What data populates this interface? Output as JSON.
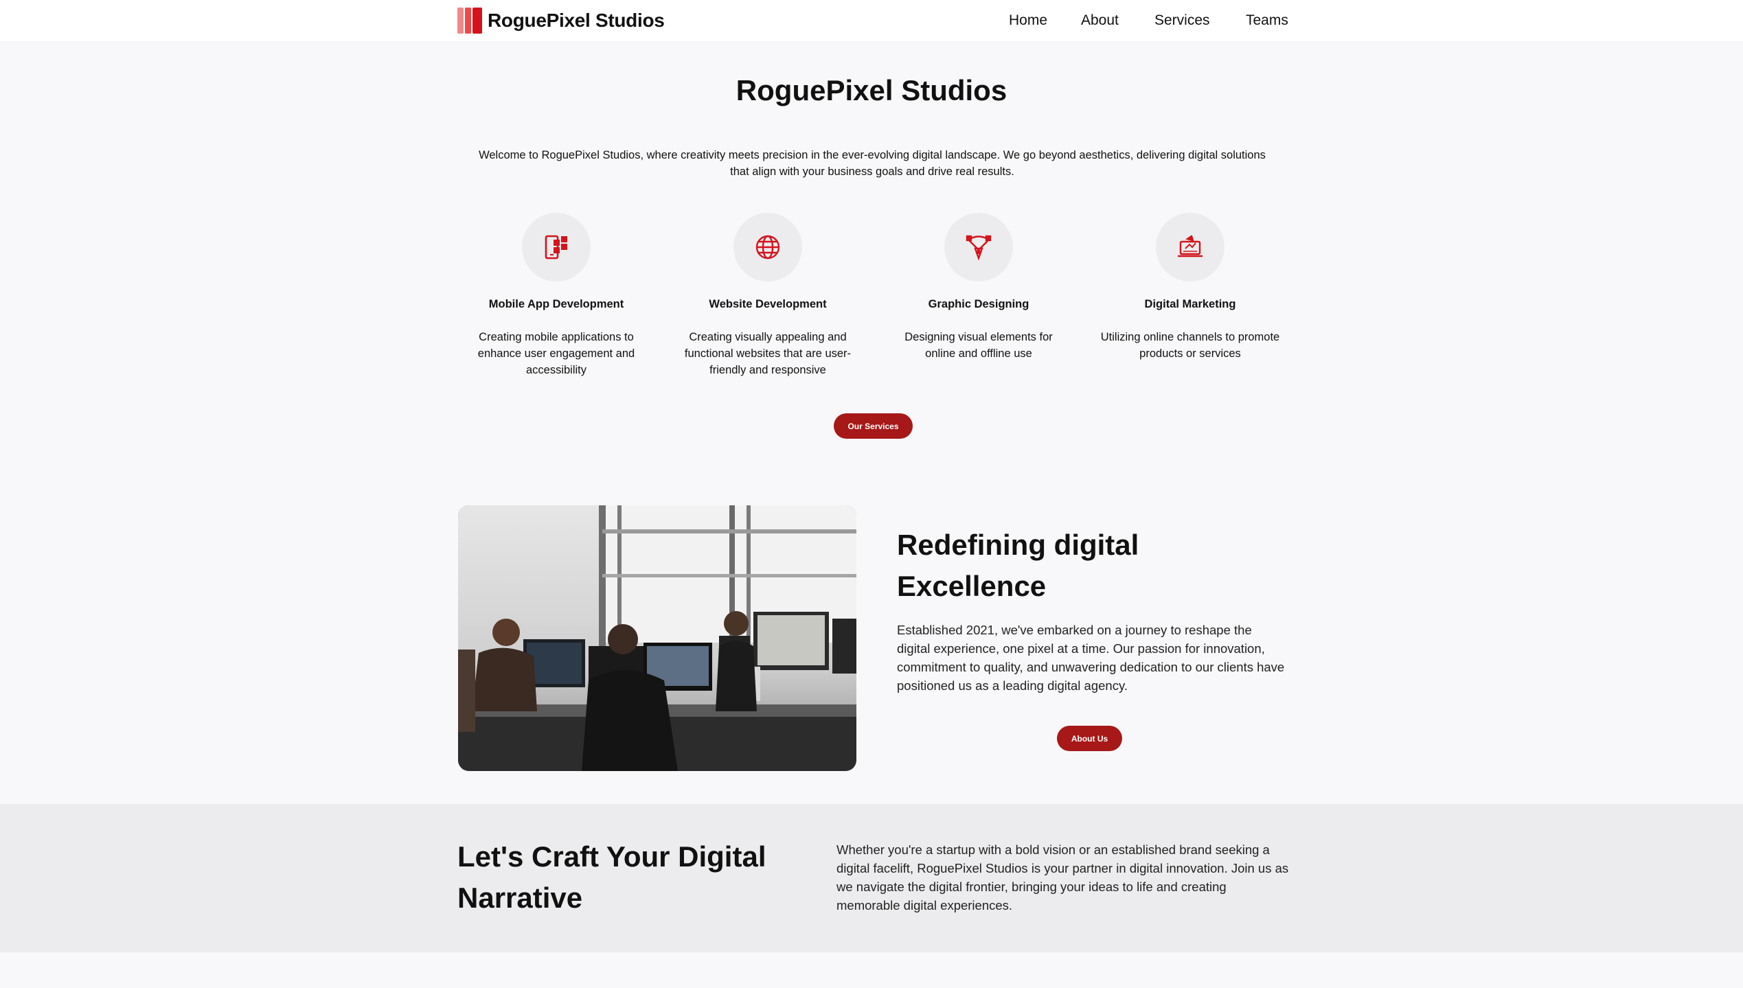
{
  "header": {
    "brand": "RoguePixel Studios",
    "nav": [
      "Home",
      "About",
      "Services",
      "Teams"
    ]
  },
  "hero": {
    "title": "RoguePixel Studios",
    "subtitle": "Welcome to RoguePixel Studios, where creativity meets precision in the ever-evolving digital landscape. We go beyond aesthetics, delivering digital solutions that align with your business goals and drive real results."
  },
  "services": [
    {
      "icon": "mobile-app-icon",
      "title": "Mobile App Development",
      "desc": "Creating mobile applications to enhance user engagement and accessibility"
    },
    {
      "icon": "globe-icon",
      "title": "Website Development",
      "desc": "Creating visually appealing and functional websites that are user-friendly and responsive"
    },
    {
      "icon": "pen-tool-icon",
      "title": "Graphic Designing",
      "desc": "Designing visual elements for online and offline use"
    },
    {
      "icon": "laptop-marketing-icon",
      "title": "Digital Marketing",
      "desc": "Utilizing online channels to promote products or services"
    }
  ],
  "services_button": "Our Services",
  "about": {
    "title": "Redefining digital Excellence",
    "text": "Established 2021, we've embarked on a journey to reshape the digital experience, one pixel at a time. Our passion for innovation, commitment to quality, and unwavering dedication to our clients have positioned us as a leading digital agency.",
    "button": "About Us"
  },
  "cta": {
    "title": "Let's Craft Your Digital Narrative",
    "text": "Whether you're a startup with a bold vision or an established brand seeking a digital facelift, RoguePixel Studios is your partner in digital innovation. Join us as we navigate the digital frontier, bringing your ideas to life and creating memorable digital experiences."
  },
  "colors": {
    "accent": "#d3141c",
    "button": "#a71818",
    "band": "#ececee",
    "page": "#f8f8fa"
  }
}
